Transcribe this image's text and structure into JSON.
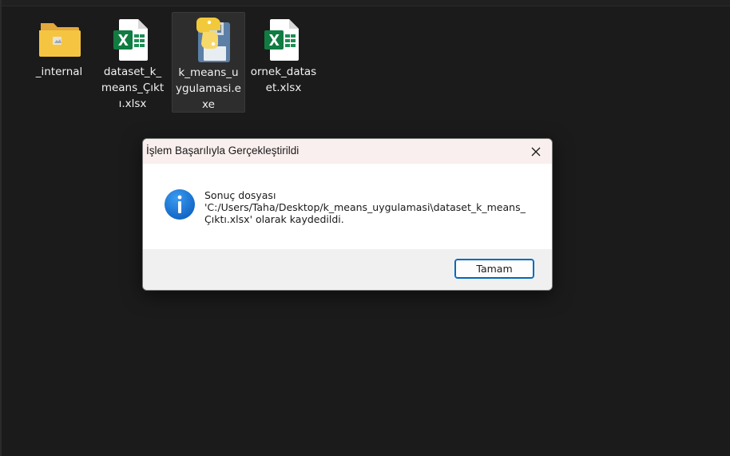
{
  "desktop": {
    "files": [
      {
        "label": "_internal",
        "icon": "folder-icon",
        "selected": false
      },
      {
        "label": "dataset_k_means_Çıktı.xlsx",
        "icon": "excel-icon",
        "selected": false
      },
      {
        "label": "k_means_uygulamasi.exe",
        "icon": "python-exe-icon",
        "selected": true
      },
      {
        "label": "ornek_dataset.xlsx",
        "icon": "excel-icon",
        "selected": false
      }
    ]
  },
  "dialog": {
    "title": "İşlem Başarılıyla Gerçekleştirildi",
    "message": "Sonuç dosyası\n'C:/Users/Taha/Desktop/k_means_uygulamasi\\dataset_k_means_Çıktı.xlsx' olarak kaydedildi.",
    "icon": "info-icon",
    "close_icon": "close-icon",
    "ok_label": "Tamam"
  },
  "colors": {
    "background": "#1b1b1b",
    "titlebar": "#f9efee",
    "footer": "#f0f0f0",
    "accent": "#0067c0",
    "info_blue": "#1473e6",
    "excel_green": "#107c41",
    "folder_yellow": "#f5c542"
  }
}
